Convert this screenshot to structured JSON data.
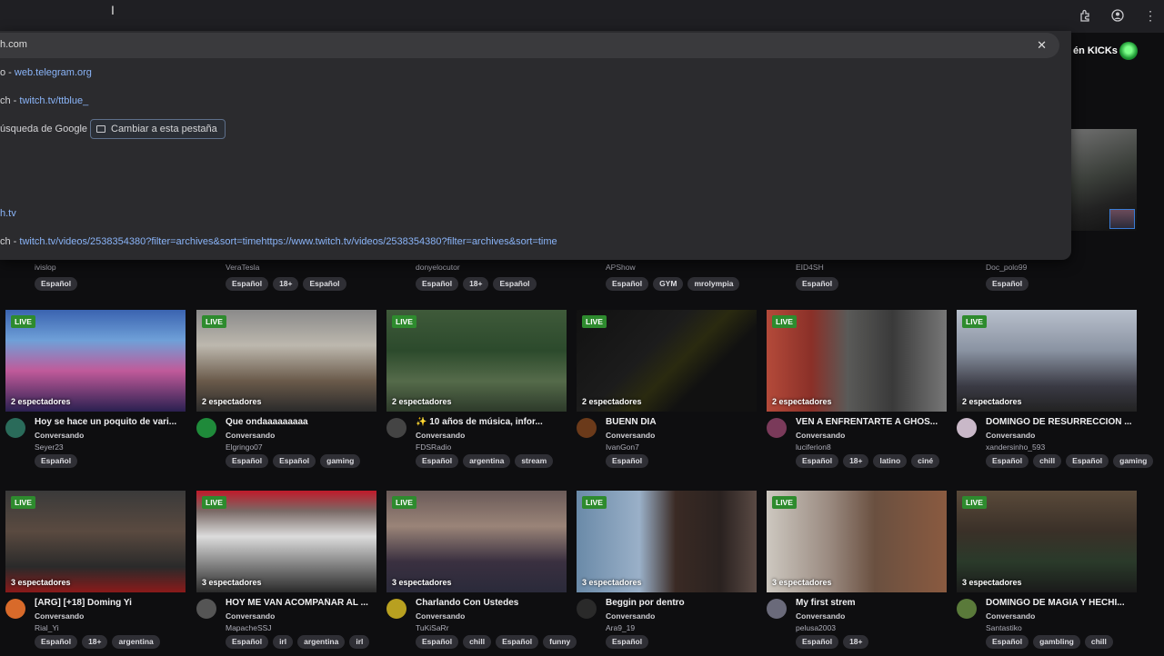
{
  "omnibox": {
    "input_value": "h.com",
    "suggestions": [
      {
        "prefix": "o - ",
        "url": "web.telegram.org"
      },
      {
        "prefix": "ch - ",
        "url": "twitch.tv/ttblue_"
      },
      {
        "prefix": "úsqueda de Google",
        "url": ""
      },
      {
        "prefix": "",
        "url": "h.tv"
      },
      {
        "prefix": "ch - ",
        "url": "twitch.tv/videos/2538354380?filter=archives&sort=timehttps://www.twitch.tv/videos/2538354380?filter=archives&sort=time"
      }
    ],
    "switch_tab_label": "Cambiar a esta pestaña"
  },
  "header": {
    "kick_label": "én KICKs"
  },
  "top_row": [
    {
      "channel": "ivislop",
      "tags": [
        "Español"
      ]
    },
    {
      "channel": "VeraTesla",
      "tags": [
        "Español",
        "18+",
        "Español"
      ]
    },
    {
      "channel": "donyelocutor",
      "tags": [
        "Español",
        "18+",
        "Español"
      ]
    },
    {
      "channel": "APShow",
      "tags": [
        "Español",
        "GYM",
        "mrolympia"
      ]
    },
    {
      "channel": "EID4SH",
      "tags": [
        "Español"
      ]
    },
    {
      "channel": "Doc_polo99",
      "tags": [
        "Español"
      ]
    }
  ],
  "streams": [
    {
      "live": "LIVE",
      "viewers": "2 espectadores",
      "title": "Hoy se hace un poquito de vari...",
      "category": "Conversando",
      "channel": "Seyer23",
      "tags": [
        "Español"
      ],
      "thumb": "linear-gradient(180deg,#3a63b0 0%,#6fa0d8 30%,#c05a9a 60%,#2a2050 100%)",
      "avatar": "#2a6b5a"
    },
    {
      "live": "LIVE",
      "viewers": "2 espectadores",
      "title": "Que ondaaaaaaaaa",
      "category": "Conversando",
      "channel": "Elgringo07",
      "tags": [
        "Español",
        "Español",
        "gaming"
      ],
      "thumb": "linear-gradient(180deg,#8a8a8a 0%,#bdb8ae 35%,#6a5a4a 70%,#2a2a2a 100%)",
      "avatar": "#1f8a3a"
    },
    {
      "live": "LIVE",
      "viewers": "2 espectadores",
      "title": "✨ 10 años de música, infor...",
      "category": "Conversando",
      "channel": "FDSRadio",
      "tags": [
        "Español",
        "argentina",
        "stream"
      ],
      "thumb": "linear-gradient(180deg,#3f5a3a 0%,#2c4a2c 40%,#556b4a 70%,#2d3a2a 100%)",
      "avatar": "#444"
    },
    {
      "live": "LIVE",
      "viewers": "2 espectadores",
      "title": "BUENN DIA",
      "category": "Conversando",
      "channel": "IvanGon7",
      "tags": [
        "Español"
      ],
      "thumb": "linear-gradient(135deg,#111 0%,#1c1c1c 40%,#2a2a10 55%,#111 70%)",
      "avatar": "#6b3a1a"
    },
    {
      "live": "LIVE",
      "viewers": "2 espectadores",
      "title": "VEN A ENFRENTARTE A GHOS...",
      "category": "Conversando",
      "channel": "luciferion8",
      "tags": [
        "Español",
        "18+",
        "latino",
        "ciné"
      ],
      "thumb": "linear-gradient(90deg,#b44a3a 0%,#8a3028 25%,#5a5a58 45%,#3a3a3a 70%,#777 100%)",
      "avatar": "#7a3a5a"
    },
    {
      "live": "LIVE",
      "viewers": "2 espectadores",
      "title": "DOMINGO DE RESURRECCION ...",
      "category": "Conversando",
      "channel": "xandersinho_593",
      "tags": [
        "Español",
        "chill",
        "Español",
        "gaming"
      ],
      "thumb": "linear-gradient(180deg,#b8c0cc 0%,#8a93a2 40%,#3a3a44 75%,#222 100%)",
      "avatar": "#c9b8c8"
    },
    {
      "live": "LIVE",
      "viewers": "3 espectadores",
      "title": "[ARG] [+18] Doming Yi",
      "category": "Conversando",
      "channel": "Rial_Yi",
      "tags": [
        "Español",
        "18+",
        "argentina"
      ],
      "thumb": "linear-gradient(180deg,#3a3a3a 0%,#5a4a40 40%,#2a2a2a 75%,#8a1a1a 100%)",
      "avatar": "#d86a2a"
    },
    {
      "live": "LIVE",
      "viewers": "3 espectadores",
      "title": "HOY ME VAN ACOMPAÑAR AL ...",
      "category": "Conversando",
      "channel": "MapacheSSJ",
      "tags": [
        "Español",
        "irl",
        "argentina",
        "irl"
      ],
      "thumb": "linear-gradient(180deg,#c01a2a 0%,#7a6a66 20%,#dcdcdc 45%,#2a2a2a 100%)",
      "avatar": "#555"
    },
    {
      "live": "LIVE",
      "viewers": "3 espectadores",
      "title": "Charlando Con Ustedes",
      "category": "Conversando",
      "channel": "TuKiSaRr",
      "tags": [
        "Español",
        "chill",
        "Español",
        "funny"
      ],
      "thumb": "linear-gradient(180deg,#6a5a58 0%,#9a8478 35%,#3a3040 70%,#2a2a3a 100%)",
      "avatar": "#b8a020"
    },
    {
      "live": "LIVE",
      "viewers": "3 espectadores",
      "title": "Beggin por dentro",
      "category": "Conversando",
      "channel": "Ara9_19",
      "tags": [
        "Español"
      ],
      "thumb": "linear-gradient(90deg,#6a8aa8 0%,#9ab0c8 35%,#3a2a24 55%,#2a2220 80%,#5a4a44 100%)",
      "avatar": "#2a2a2a"
    },
    {
      "live": "LIVE",
      "viewers": "3 espectadores",
      "title": "My first strem",
      "category": "Conversando",
      "channel": "pelusa2003",
      "tags": [
        "Español",
        "18+"
      ],
      "thumb": "linear-gradient(90deg,#cdc8c0 0%,#9a8a80 35%,#6a5040 60%,#8a5a40 100%)",
      "avatar": "#6a6a7a"
    },
    {
      "live": "LIVE",
      "viewers": "3 espectadores",
      "title": "DOMINGO DE MAGIA Y HECHI...",
      "category": "Conversando",
      "channel": "Santastiko",
      "tags": [
        "Español",
        "gambling",
        "chill"
      ],
      "thumb": "linear-gradient(180deg,#5a4a3a 0%,#3a3028 40%,#2a3a2a 70%,#1a1a1a 100%)",
      "avatar": "#5a7a3a"
    }
  ]
}
